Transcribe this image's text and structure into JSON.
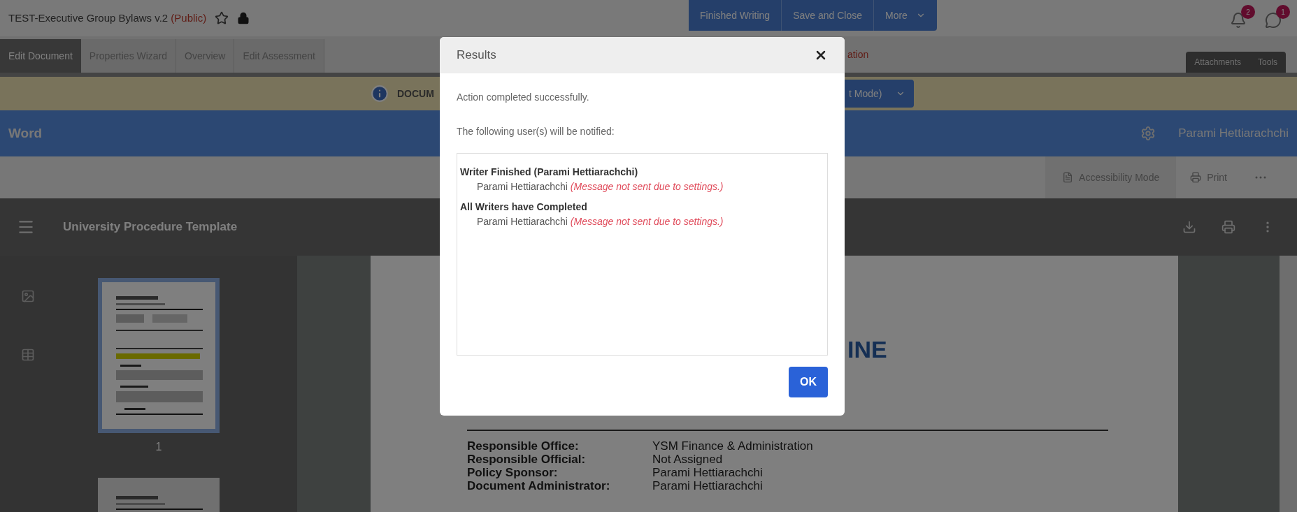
{
  "header": {
    "title": "TEST-Executive Group Bylaws v.2",
    "visibility": "(Public)",
    "starred": false,
    "locked": true,
    "actions": [
      "Finished Writing",
      "Save and Close"
    ],
    "more_button": "More",
    "notifications": [
      {
        "kind": "bell",
        "badge": "2"
      },
      {
        "kind": "chat",
        "badge": "1"
      }
    ]
  },
  "tabs": [
    {
      "label": "Edit Document",
      "selected": true
    },
    {
      "label": "Properties Wizard",
      "selected": false
    },
    {
      "label": "Overview",
      "selected": false
    },
    {
      "label": "Edit Assessment",
      "selected": false
    }
  ],
  "tab_row_partial": "ation",
  "side_tabs": [
    "Attachments",
    "Tools"
  ],
  "notice_bar": {
    "text": "DOCUM",
    "mode_button": "t Mode)"
  },
  "app_bar": {
    "title": "Word",
    "user": "Parami Hettiarachchi"
  },
  "toolbar": {
    "buttons": [
      {
        "kind": "accessibility",
        "label": "Accessibility Mode"
      },
      {
        "kind": "print",
        "label": "Print"
      },
      {
        "kind": "more"
      }
    ]
  },
  "viewer": {
    "title": "University Procedure Template",
    "thumbnails": [
      {
        "page": "1",
        "selected": true
      },
      {
        "selected": false
      }
    ],
    "page_heading": "INE",
    "fields": [
      {
        "label": "Responsible Office:",
        "value": "YSM Finance & Administration"
      },
      {
        "label": "Responsible Official:",
        "value": "Not Assigned"
      },
      {
        "label": "Policy Sponsor:",
        "value": "Parami Hettiarachchi"
      },
      {
        "label": "Document Administrator:",
        "value": "Parami Hettiarachchi"
      }
    ]
  },
  "dialog": {
    "title": "Results",
    "message": "Action completed successfully.",
    "intro": "The following user(s) will be notified:",
    "groups": [
      {
        "title": "Writer Finished (Parami Hettiarachchi)",
        "recipients": [
          {
            "name": "Parami Hettiarachchi",
            "note": "(Message not sent due to settings.)"
          }
        ]
      },
      {
        "title": "All Writers have Completed",
        "recipients": [
          {
            "name": "Parami Hettiarachchi",
            "note": "(Message not sent due to settings.)"
          }
        ]
      }
    ],
    "ok_button": "OK"
  }
}
